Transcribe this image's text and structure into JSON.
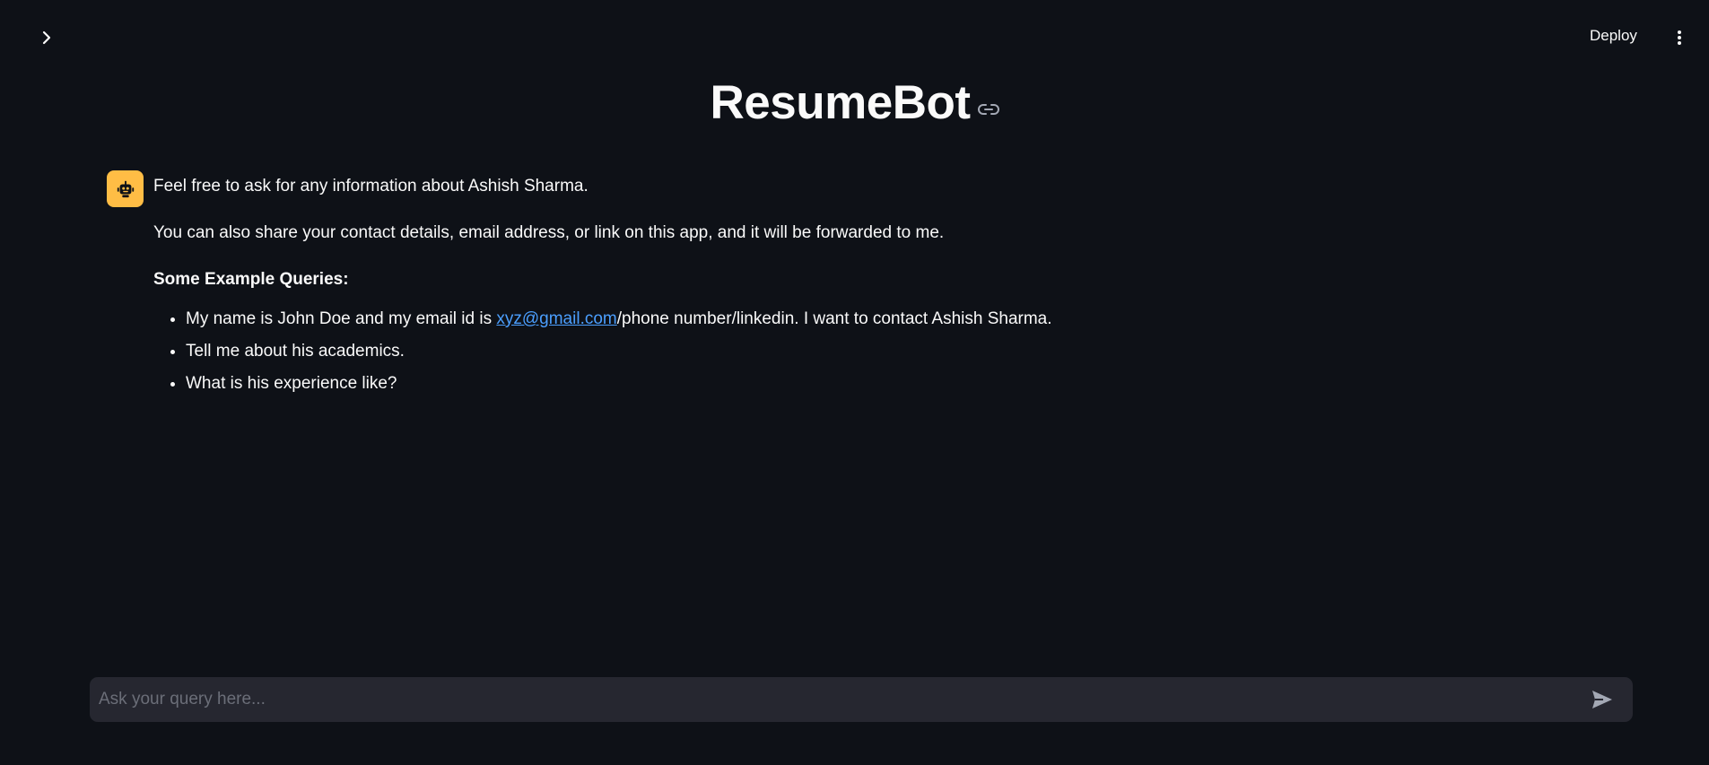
{
  "header": {
    "deploy_label": "Deploy",
    "sidebar_toggle_icon": "chevron-right-icon",
    "menu_icon": "kebab-menu-icon"
  },
  "title": "ResumeBot",
  "message": {
    "avatar_icon": "robot-icon",
    "avatar_color": "#ffbd45",
    "line1": "Feel free to ask for any information about Ashish Sharma.",
    "line2": "You can also share your contact details, email address, or link on this app, and it will be forwarded to me.",
    "examples_heading": "Some Example Queries:",
    "examples": [
      {
        "prefix": "My name is John Doe and my email id is ",
        "link": "xyz@gmail.com",
        "suffix": "/phone number/linkedin. I want to contact Ashish Sharma."
      },
      {
        "text": "Tell me about his academics."
      },
      {
        "text": "What is his experience like?"
      }
    ]
  },
  "chat_input": {
    "placeholder": "Ask your query here...",
    "value": "",
    "send_icon": "send-icon"
  },
  "colors": {
    "background": "#0e1117",
    "input_background": "#262730",
    "link": "#4b9fff"
  }
}
